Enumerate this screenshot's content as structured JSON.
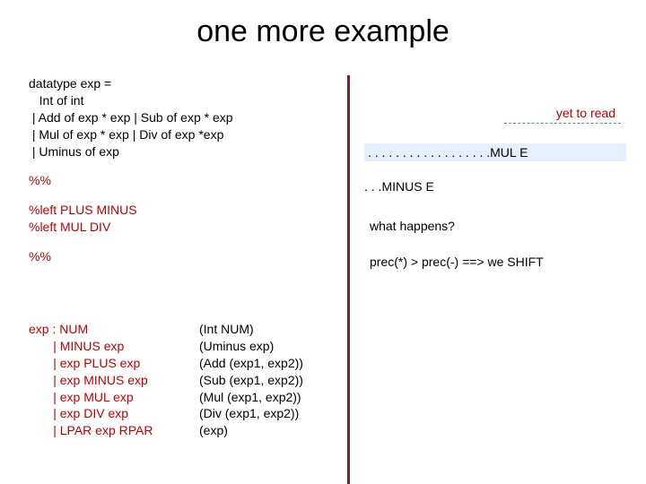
{
  "title": "one more example",
  "datatype": {
    "l1": "datatype exp =",
    "l2": "   Int of int",
    "l3": " | Add of exp * exp | Sub of exp * exp",
    "l4": " | Mul of exp * exp | Div of exp *exp",
    "l5": " | Uminus of exp"
  },
  "sep1": "%%",
  "assoc": {
    "l1": "%left PLUS MINUS",
    "l2": "%left MUL DIV"
  },
  "sep2": "%%",
  "grammar": {
    "head": "exp : NUM",
    "r1": "       | MINUS exp",
    "r2": "       | exp PLUS exp",
    "r3": "       | exp MINUS exp",
    "r4": "       | exp MUL exp",
    "r5": "       | exp DIV exp",
    "r6": "       | LPAR exp RPAR"
  },
  "sema": {
    "s0": "(Int NUM)",
    "s1": "(Uminus exp)",
    "s2": "(Add (exp1, exp2))",
    "s3": "(Sub (exp1, exp2))",
    "s4": "(Mul (exp1, exp2))",
    "s5": "(Div (exp1, exp2))",
    "s6": "(exp)"
  },
  "right": {
    "yet": "yet to read",
    "mul": ". . . . . . . . . . . . . . . . . .MUL E",
    "minus": ". . .MINUS E",
    "what": "what happens?",
    "prec": "prec(*) > prec(-) ==> we SHIFT"
  }
}
